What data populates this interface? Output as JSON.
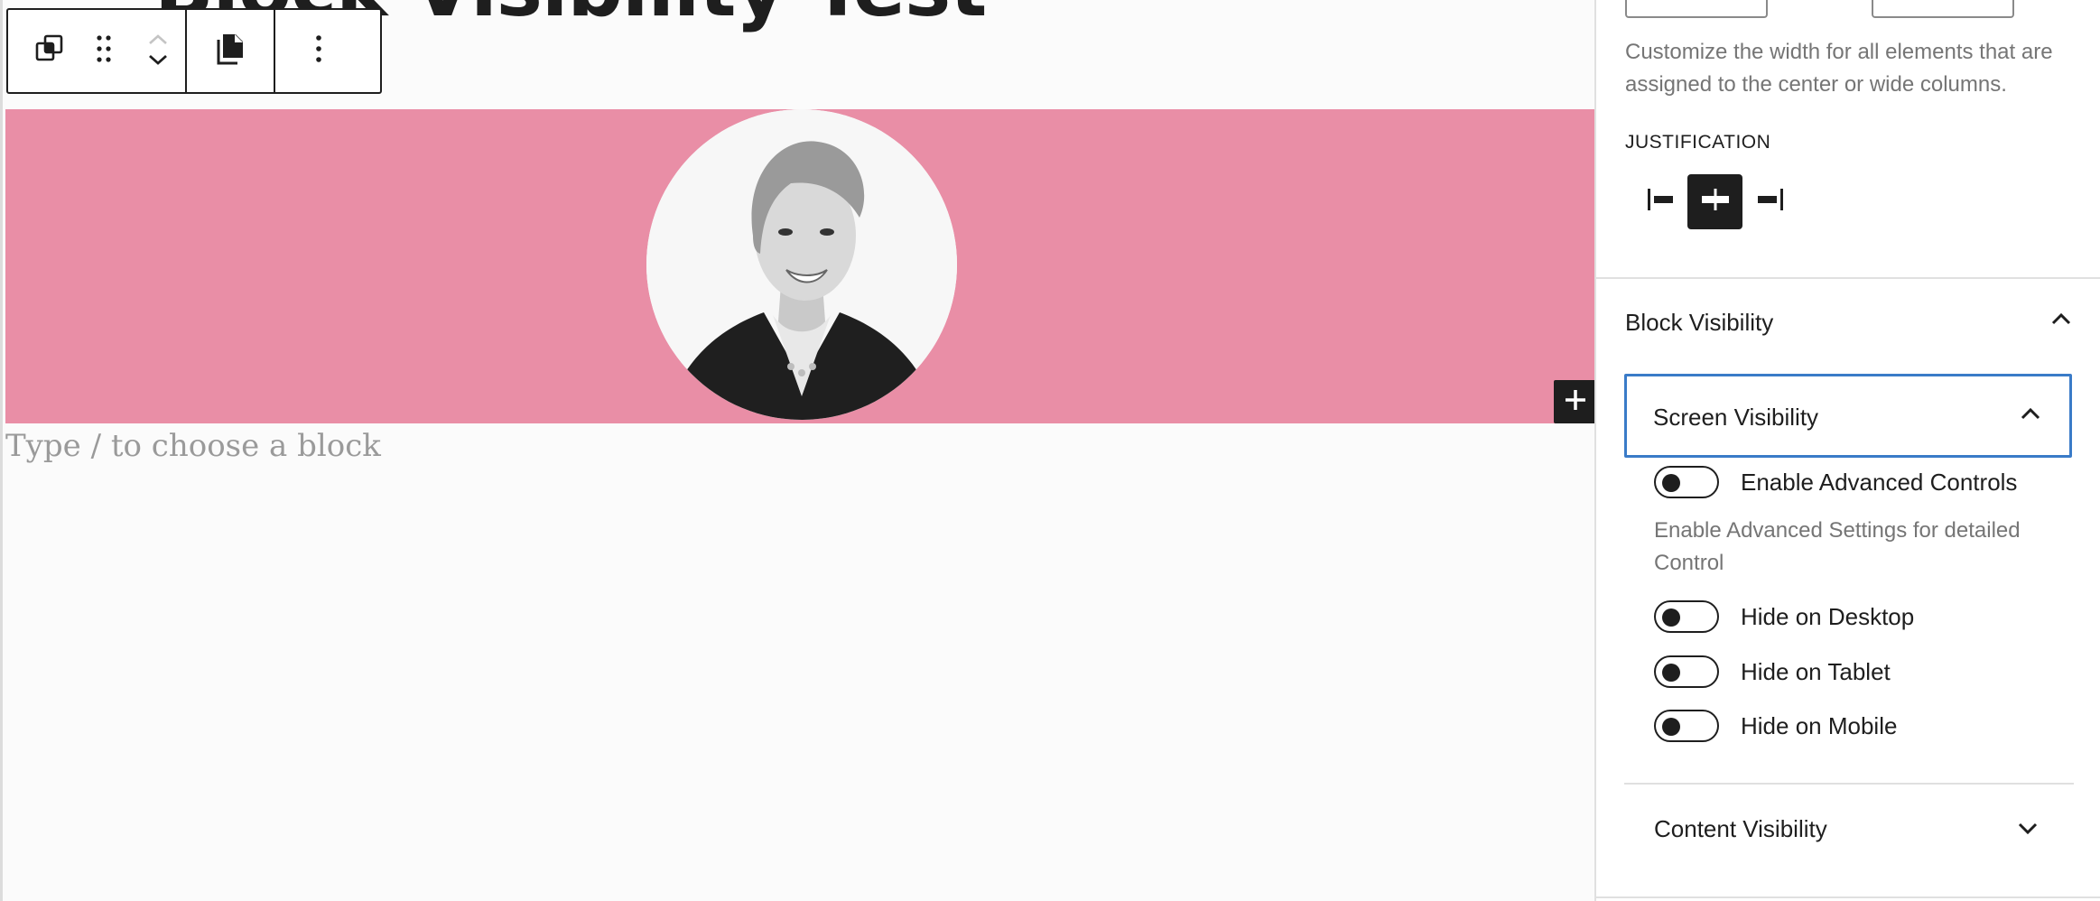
{
  "post": {
    "title": "Block Visibility Test",
    "placeholder": "Type / to choose a block"
  },
  "toolbar": {
    "icons": [
      "duplicate-icon",
      "drag-handle-icon",
      "chevron-up-icon",
      "chevron-down-icon",
      "page-icon",
      "more-vertical-icon"
    ]
  },
  "sidebar": {
    "layout_help": "Customize the width for all elements that are assigned to the center or wide columns.",
    "justification": {
      "label": "Justification",
      "options": [
        "justify-left-icon",
        "justify-center-icon",
        "justify-right-icon"
      ],
      "active": "center"
    },
    "block_visibility": {
      "title": "Block Visibility",
      "screen_visibility": {
        "title": "Screen Visibility",
        "expanded": true,
        "enable_advanced": {
          "label": "Enable Advanced Controls",
          "on": false
        },
        "advanced_help": "Enable Advanced Settings for detailed Control",
        "hide_desktop": {
          "label": "Hide on Desktop",
          "on": false
        },
        "hide_tablet": {
          "label": "Hide on Tablet",
          "on": false
        },
        "hide_mobile": {
          "label": "Hide on Mobile",
          "on": false
        }
      },
      "content_visibility": {
        "title": "Content Visibility",
        "expanded": false
      }
    }
  },
  "colors": {
    "cover_background": "#e98ea6",
    "focus_border": "#3a7bc8",
    "text_dark": "#1e1e1e",
    "text_muted": "#757575"
  }
}
